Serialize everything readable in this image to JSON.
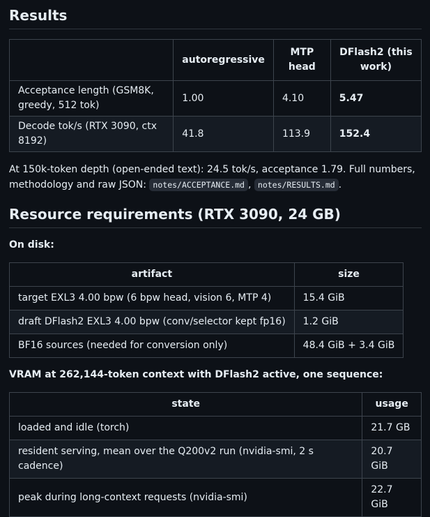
{
  "results": {
    "heading": "Results",
    "columns": [
      "",
      "autoregressive",
      "MTP head",
      "DFlash2 (this work)"
    ],
    "rows": [
      {
        "metric": "Acceptance length (GSM8K, greedy, 512 tok)",
        "ar": "1.00",
        "mtp": "4.10",
        "dflash": "5.47"
      },
      {
        "metric": "Decode tok/s (RTX 3090, ctx 8192)",
        "ar": "41.8",
        "mtp": "113.9",
        "dflash": "152.4"
      }
    ],
    "note_text": "At 150k-token depth (open-ended text): 24.5 tok/s, acceptance 1.79. Full numbers, methodology and raw JSON: ",
    "note_code1": "notes/ACCEPTANCE.md",
    "note_sep": ", ",
    "note_code2": "notes/RESULTS.md",
    "note_end": "."
  },
  "resources": {
    "heading": "Resource requirements (RTX 3090, 24 GB)",
    "disk_label": "On disk:",
    "disk_columns": [
      "artifact",
      "size"
    ],
    "disk_rows": [
      {
        "artifact": "target EXL3 4.00 bpw (6 bpw head, vision 6, MTP 4)",
        "size": "15.4 GiB"
      },
      {
        "artifact": "draft DFlash2 EXL3 4.00 bpw (conv/selector kept fp16)",
        "size": "1.2 GiB"
      },
      {
        "artifact": "BF16 sources (needed for conversion only)",
        "size": "48.4 GiB + 3.4 GiB"
      }
    ],
    "vram_label": "VRAM at 262,144-token context with DFlash2 active, one sequence:",
    "vram_columns": [
      "state",
      "usage"
    ],
    "vram_rows": [
      {
        "state": "loaded and idle (torch)",
        "usage": "21.7 GB"
      },
      {
        "state": "resident serving, mean over the Q200v2 run (nvidia-smi, 2 s cadence)",
        "usage": "20.7 GiB"
      },
      {
        "state": "peak during long-context requests (nvidia-smi)",
        "usage": "22.7 GiB"
      }
    ]
  }
}
